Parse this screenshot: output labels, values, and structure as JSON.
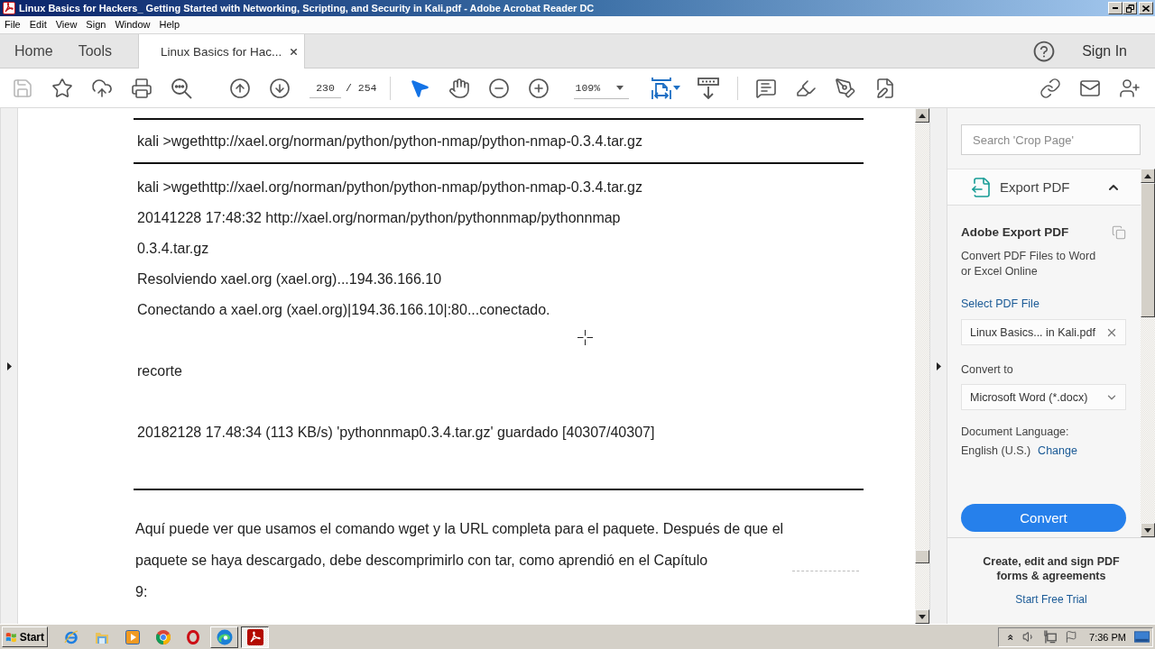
{
  "window": {
    "title": "Linux Basics for Hackers_ Getting Started with Networking, Scripting, and Security in Kali.pdf - Adobe Acrobat Reader DC"
  },
  "menu": [
    "File",
    "Edit",
    "View",
    "Sign",
    "Window",
    "Help"
  ],
  "tabs": [
    {
      "kind": "nav",
      "label": "Home",
      "selected": false
    },
    {
      "kind": "nav",
      "label": "Tools",
      "selected": false
    },
    {
      "kind": "document",
      "label": "Linux Basics for Hac...",
      "selected": true
    }
  ],
  "account": {
    "sign_in": "Sign In"
  },
  "toolbar": {
    "page": "230",
    "page_total": "/ 254",
    "tools": [
      {
        "kind": "select",
        "selected": true
      },
      {
        "kind": "hand",
        "selected": false
      }
    ],
    "zoom": "109%"
  },
  "document": {
    "command": "kali >wgethttp://xael.org/norman/python/python-nmap/python-nmap-0.3.4.tar.gz",
    "output_blocks": [
      {
        "lines": [
          "kali >wgethttp://xael.org/norman/python/python-nmap/python-nmap-0.3.4.tar.gz",
          "20141228 17:48:32 http://xael.org/norman/python/pythonnmap/pythonnmap",
          "0.3.4.tar.gz",
          "Resolviendo xael.org (xael.org)...194.36.166.10",
          "Conectando a xael.org (xael.org)|194.36.166.10|:80...conectado."
        ]
      },
      {
        "lines": [
          "recorte"
        ]
      },
      {
        "lines": [
          "20182128 17.48:34 (113 KB/s) 'pythonnmap0.3.4.tar.gz' guardado [40307/40307]"
        ]
      }
    ],
    "paragraph_lines": [
      "Aquí puede ver que usamos el comando wget y la URL completa para el paquete. Después de que el",
      "paquete se haya descargado, debe descomprimirlo con tar, como aprendió en el Capítulo",
      "9:"
    ]
  },
  "tools_panel": {
    "search": {
      "placeholder": "Search 'Crop Page'"
    },
    "section": {
      "title": "Export PDF",
      "expanded": true
    },
    "heading": "Adobe Export PDF",
    "description": "Convert PDF Files to Word or Excel Online",
    "select_file_link": "Select PDF File",
    "file": "Linux Basics... in Kali.pdf",
    "convert_to_label": "Convert to",
    "format": "Microsoft Word (*.docx)",
    "language_label": "Document Language:",
    "language": "English (U.S.)",
    "change_link": "Change",
    "convert_button": "Convert",
    "promo": {
      "title": "Create, edit and sign PDF forms & agreements",
      "link": "Start Free Trial"
    }
  },
  "taskbar": {
    "start": "Start",
    "apps": [
      {
        "kind": "edge",
        "selected": false
      },
      {
        "kind": "acrobat",
        "selected": true
      }
    ],
    "clock": "7:36 PM"
  }
}
